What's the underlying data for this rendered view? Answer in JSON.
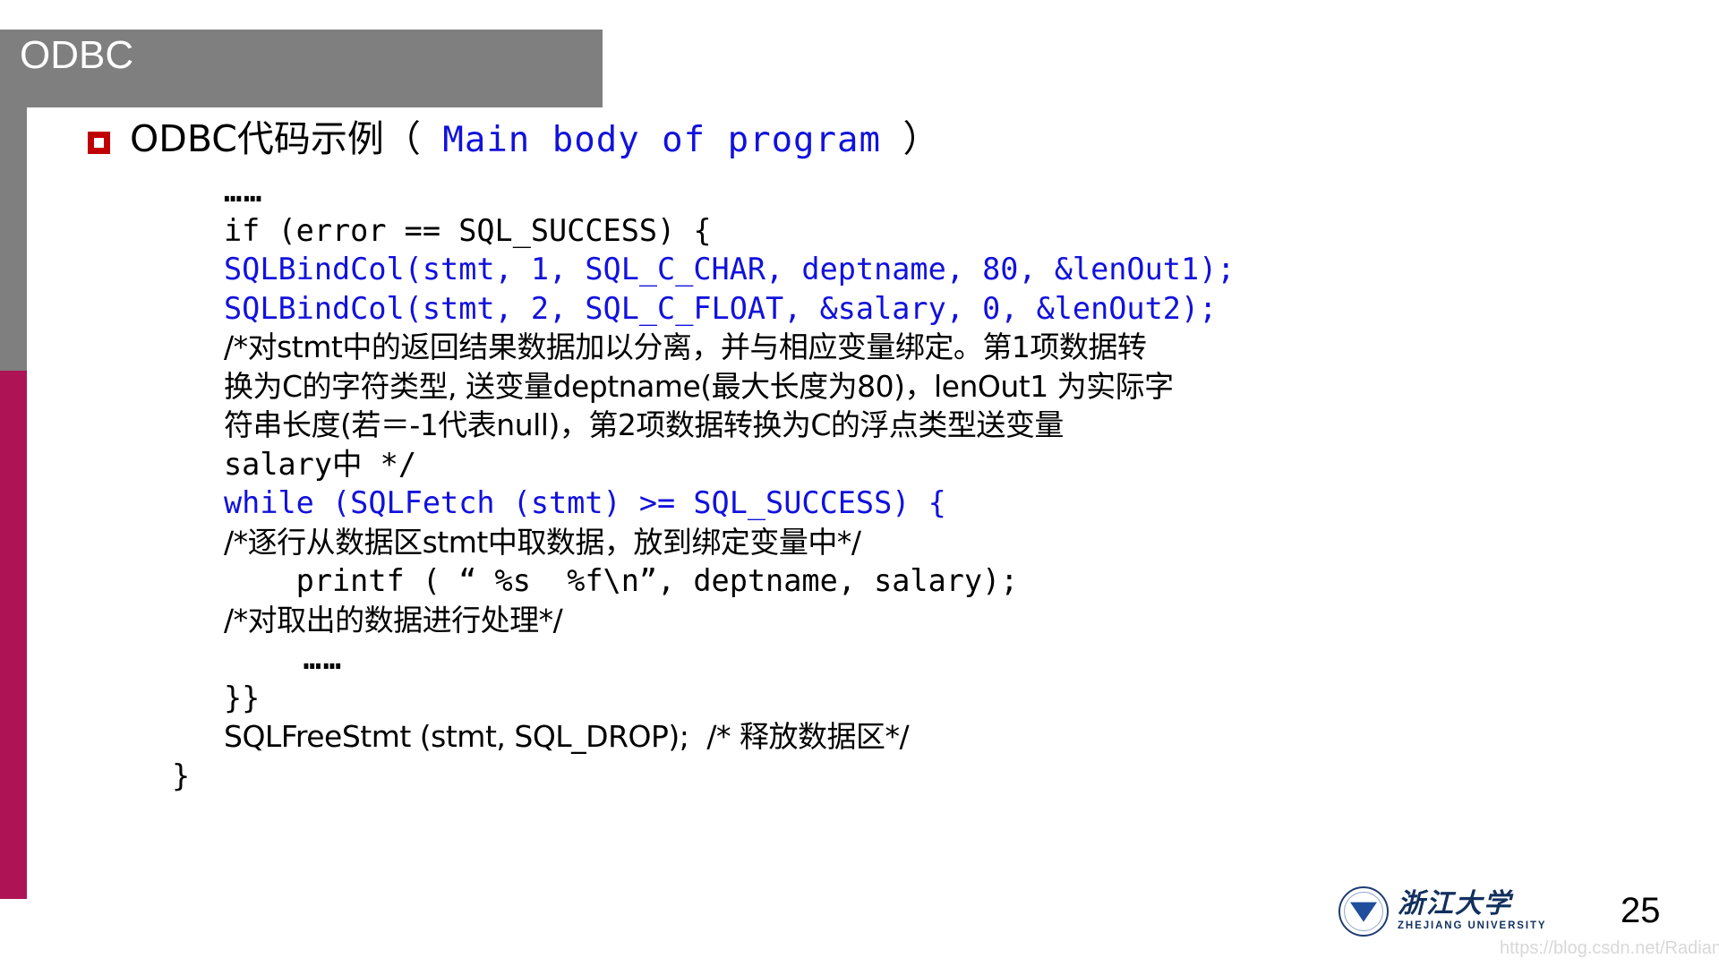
{
  "slide": {
    "title": "ODBC",
    "page_number": "25",
    "watermark": "https://blog.csdn.net/RadiantJeral",
    "colors": {
      "banner_gray": "#7f7f7f",
      "rail_magenta": "#ae1455",
      "bullet_red": "#c00000",
      "code_blue": "#1111dd",
      "text_black": "#000000"
    }
  },
  "bullet": {
    "marker": "square-bullet-icon",
    "text_cn": "ODBC代码示例（",
    "text_en": " Main body of program ",
    "text_close": "）"
  },
  "code": {
    "lines": [
      {
        "id": "l01",
        "color": "black",
        "style": "ellipsis",
        "text": "……"
      },
      {
        "id": "l02",
        "color": "black",
        "style": "code",
        "text": "if (error == SQL_SUCCESS) {"
      },
      {
        "id": "l03",
        "color": "blue",
        "style": "code",
        "text": "SQLBindCol(stmt, 1, SQL_C_CHAR, deptname, 80, &lenOut1);"
      },
      {
        "id": "l04",
        "color": "blue",
        "style": "code",
        "text": "SQLBindCol(stmt, 2, SQL_C_FLOAT, &salary, 0, &lenOut2);"
      },
      {
        "id": "l05",
        "color": "black",
        "style": "cjk",
        "text": "/*对stmt中的返回结果数据加以分离，并与相应变量绑定。第1项数据转"
      },
      {
        "id": "l06",
        "color": "black",
        "style": "cjk",
        "text": "换为C的字符类型, 送变量deptname(最大长度为80)，lenOut1 为实际字"
      },
      {
        "id": "l07",
        "color": "black",
        "style": "cjk",
        "text": "符串长度(若＝-1代表null)，第2项数据转换为C的浮点类型送变量"
      },
      {
        "id": "l08",
        "color": "black",
        "style": "code",
        "text": "salary中 */"
      },
      {
        "id": "l09",
        "color": "blue",
        "style": "code",
        "text": "while (SQLFetch (stmt) >= SQL_SUCCESS) {"
      },
      {
        "id": "l10",
        "color": "black",
        "style": "cjk",
        "text": "/*逐行从数据区stmt中取数据，放到绑定变量中*/"
      },
      {
        "id": "l11",
        "color": "black",
        "style": "code",
        "text": "    printf ( “ %s  %f\\n”, deptname, salary);"
      },
      {
        "id": "l12",
        "color": "black",
        "style": "cjk",
        "text": "/*对取出的数据进行处理*/"
      },
      {
        "id": "l13",
        "color": "black",
        "style": "ellipsis",
        "text": "    ……"
      },
      {
        "id": "l14",
        "color": "black",
        "style": "code",
        "text": "}}"
      },
      {
        "id": "l15",
        "color": "black",
        "style": "cjk",
        "text": "SQLFreeStmt (stmt, SQL_DROP);  /* 释放数据区*/"
      },
      {
        "id": "l16",
        "color": "black",
        "style": "closing",
        "text": "}"
      }
    ]
  },
  "footer": {
    "logo_cn": "浙江大学",
    "logo_en": "ZHEJIANG UNIVERSITY"
  }
}
